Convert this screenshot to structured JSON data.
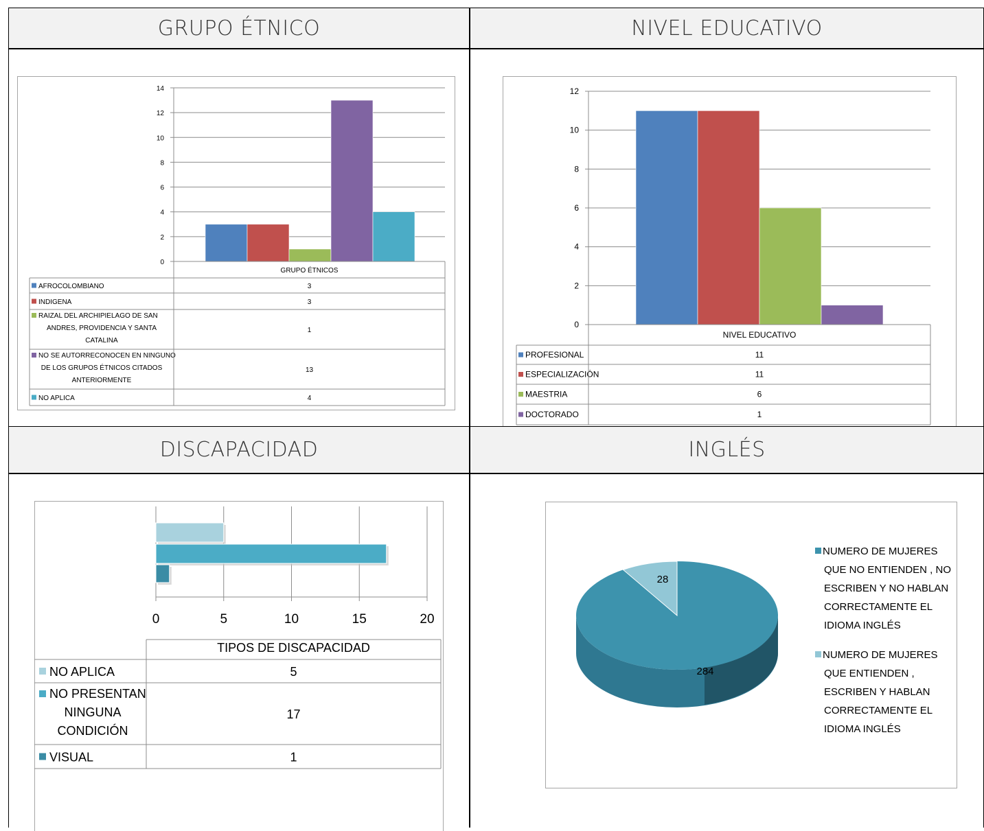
{
  "headers": {
    "grupo_etnico": "GRUPO ÉTNICO",
    "nivel_educativo": "NIVEL EDUCATIVO",
    "discapacidad": "DISCAPACIDAD",
    "ingles": "INGLÉS"
  },
  "colors": {
    "blue": "#4f81bd",
    "red": "#c0504d",
    "green": "#9bbb59",
    "purple": "#8064a2",
    "aqua": "#4bacc6",
    "light_aqua": "#a9d2de",
    "teal": "#3a8ca5",
    "pie_main": "#3d93ad",
    "pie_minor": "#92c7d6"
  },
  "chart_data": [
    {
      "type": "bar",
      "category_label": "GRUPO ÉTNICOS",
      "ylim": [
        0,
        14
      ],
      "yticks": [
        0,
        2,
        4,
        6,
        8,
        10,
        12,
        14
      ],
      "grid": true,
      "series": [
        {
          "name": "AFROCOLOMBIANO",
          "lines": [
            "AFROCOLOMBIANO"
          ],
          "value": 3,
          "color": "#4f81bd"
        },
        {
          "name": "INDIGENA",
          "lines": [
            "INDIGENA"
          ],
          "value": 3,
          "color": "#c0504d"
        },
        {
          "name": "RAIZAL DEL ARCHIPIELAGO DE SAN ANDRES, PROVIDENCIA Y SANTA CATALINA",
          "lines": [
            "RAIZAL DEL ARCHIPIELAGO DE SAN",
            "ANDRES, PROVIDENCIA Y SANTA",
            "CATALINA"
          ],
          "value": 1,
          "color": "#9bbb59"
        },
        {
          "name": "NO SE AUTORRECONOCEN EN NINGUNO DE LOS GRUPOS ÉTNICOS CITADOS ANTERIORMENTE",
          "lines": [
            "NO SE AUTORRECONOCEN EN NINGUNO",
            "DE LOS GRUPOS ÉTNICOS CITADOS",
            "ANTERIORMENTE"
          ],
          "value": 13,
          "color": "#8064a2"
        },
        {
          "name": "NO APLICA",
          "lines": [
            "NO APLICA"
          ],
          "value": 4,
          "color": "#4bacc6"
        }
      ]
    },
    {
      "type": "bar",
      "category_label": "NIVEL EDUCATIVO",
      "ylim": [
        0,
        12
      ],
      "yticks": [
        0,
        2,
        4,
        6,
        8,
        10,
        12
      ],
      "grid": true,
      "series": [
        {
          "name": "PROFESIONAL",
          "lines": [
            "PROFESIONAL"
          ],
          "value": 11,
          "color": "#4f81bd"
        },
        {
          "name": "ESPECIALIZACIÓN",
          "lines": [
            "ESPECIALIZACIÓN"
          ],
          "value": 11,
          "color": "#c0504d"
        },
        {
          "name": "MAESTRIA",
          "lines": [
            "MAESTRIA"
          ],
          "value": 6,
          "color": "#9bbb59"
        },
        {
          "name": "DOCTORADO",
          "lines": [
            "DOCTORADO"
          ],
          "value": 1,
          "color": "#8064a2"
        }
      ]
    },
    {
      "type": "bar",
      "orientation": "horizontal",
      "category_label": "TIPOS DE DISCAPACIDAD",
      "xlim": [
        0,
        20
      ],
      "xticks": [
        0,
        5,
        10,
        15,
        20
      ],
      "grid": true,
      "series": [
        {
          "name": "NO APLICA",
          "lines": [
            "NO APLICA"
          ],
          "value": 5,
          "color": "#a9d2de"
        },
        {
          "name": "NO PRESENTAN NINGUNA CONDICIÓN",
          "lines": [
            "NO PRESENTAN",
            "NINGUNA",
            "CONDICIÓN"
          ],
          "value": 17,
          "color": "#4bacc6"
        },
        {
          "name": "VISUAL",
          "lines": [
            "VISUAL"
          ],
          "value": 1,
          "color": "#3a8ca5"
        }
      ]
    },
    {
      "type": "pie",
      "slices": [
        {
          "name": "NUMERO DE MUJERES QUE NO ENTIENDEN , NO ESCRIBEN Y NO HABLAN CORRECTAMENTE EL IDIOMA INGLÉS",
          "lines": [
            "NUMERO DE MUJERES",
            "QUE NO ENTIENDEN , NO",
            "ESCRIBEN Y NO HABLAN",
            "CORRECTAMENTE EL",
            "IDIOMA INGLÉS"
          ],
          "value": 284,
          "color": "#3d93ad"
        },
        {
          "name": " NUMERO DE MUJERES QUE ENTIENDEN , ESCRIBEN Y HABLAN CORRECTAMENTE EL IDIOMA INGLÉS",
          "lines": [
            " NUMERO DE MUJERES",
            "QUE ENTIENDEN ,",
            "ESCRIBEN Y HABLAN",
            "CORRECTAMENTE EL",
            "IDIOMA INGLÉS"
          ],
          "value": 28,
          "color": "#92c7d6"
        }
      ],
      "legend_position": "right"
    }
  ]
}
